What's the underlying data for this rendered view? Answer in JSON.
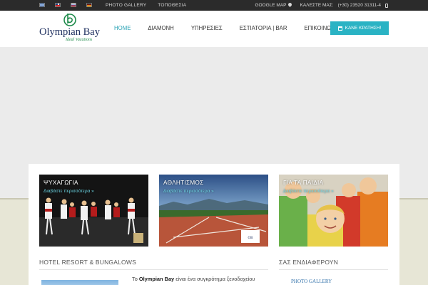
{
  "topbar": {
    "languages": [
      {
        "code": "gr",
        "icon": "greek-flag-icon"
      },
      {
        "code": "en",
        "icon": "uk-flag-icon"
      },
      {
        "code": "ru",
        "icon": "russian-flag-icon"
      },
      {
        "code": "de",
        "icon": "german-flag-icon"
      }
    ],
    "links": [
      "PHOTO GALLERY",
      "ΤΟΠΟΘΕΣΙΑ"
    ],
    "map_label": "GOOGLE MAP",
    "call_label": "ΚΑΛΕΣΤΕ ΜΑΣ:",
    "phone": "(+30) 23520 31311-4"
  },
  "header": {
    "logo_name": "Olympian Bay",
    "logo_tagline": "Ideal Vacations",
    "nav": [
      "HOME",
      "ΔΙΑΜΟΝΗ",
      "ΥΠΗΡΕΣΙΕΣ",
      "ΕΣΤΙΑΤΟΡΙΑ | BAR",
      "ΕΠΙΚΟΙΝΩΝΙΑ"
    ],
    "active_nav": "HOME",
    "book_label": "ΚΑΝΕ ΚΡΑΤΗΣΗ!"
  },
  "cards": [
    {
      "title": "ΨΥΧΑΓΩΓΙΑ",
      "more": "Διαβάστε περισσότερα »"
    },
    {
      "title": "ΑΘΛΗΤΙΣΜΟΣ",
      "more": "Διαβάστε περισσότερα »"
    },
    {
      "title": "ΓΙΑ ΤΑ ΠΑΙΔΙΑ",
      "more": "Διαβάστε περισσότερα »"
    }
  ],
  "sections": {
    "hotel_title": "HOTEL RESORT & BUNGALOWS",
    "interest_title": "ΣΑΣ ΕΝΔΙΑΦΕΡΟΥΝ",
    "intro_prefix": "Το",
    "intro_brand": "Olympian Bay",
    "intro_rest": "είναι ένα συγκρότημα ξενοδοχείου",
    "interest_button": "PHOTO GALLERY"
  },
  "colors": {
    "accent": "#2ab3c4",
    "topbar": "#2b2b2b",
    "logo_blue": "#1e2f5f",
    "logo_green": "#1e8a4a"
  }
}
